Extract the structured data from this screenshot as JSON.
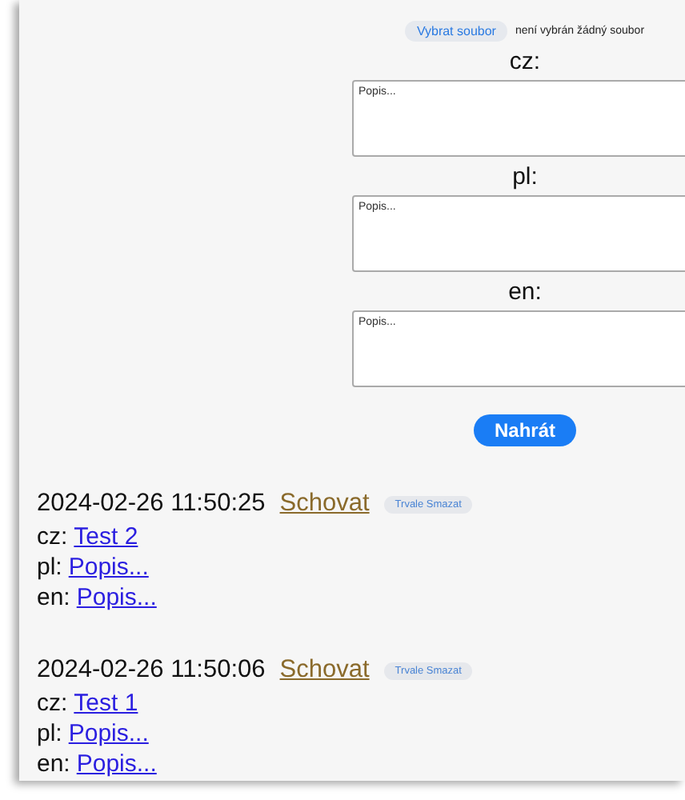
{
  "upload_form": {
    "file_button": "Vybrat soubor",
    "file_status": "není vybrán žádný soubor",
    "fields": [
      {
        "label": "cz:",
        "placeholder": "Popis..."
      },
      {
        "label": "pl:",
        "placeholder": "Popis..."
      },
      {
        "label": "en:",
        "placeholder": "Popis..."
      }
    ],
    "submit": "Nahrát"
  },
  "entries": [
    {
      "timestamp": "2024-02-26 11:50:25",
      "hide_link": "Schovat",
      "delete_button": "Trvale Smazat",
      "descriptions": [
        {
          "lang": "cz:",
          "text": "Test 2"
        },
        {
          "lang": "pl:",
          "text": "Popis..."
        },
        {
          "lang": "en:",
          "text": "Popis..."
        }
      ]
    },
    {
      "timestamp": "2024-02-26 11:50:06",
      "hide_link": "Schovat",
      "delete_button": "Trvale Smazat",
      "descriptions": [
        {
          "lang": "cz:",
          "text": "Test 1"
        },
        {
          "lang": "pl:",
          "text": "Popis..."
        },
        {
          "lang": "en:",
          "text": "Popis..."
        }
      ]
    }
  ]
}
